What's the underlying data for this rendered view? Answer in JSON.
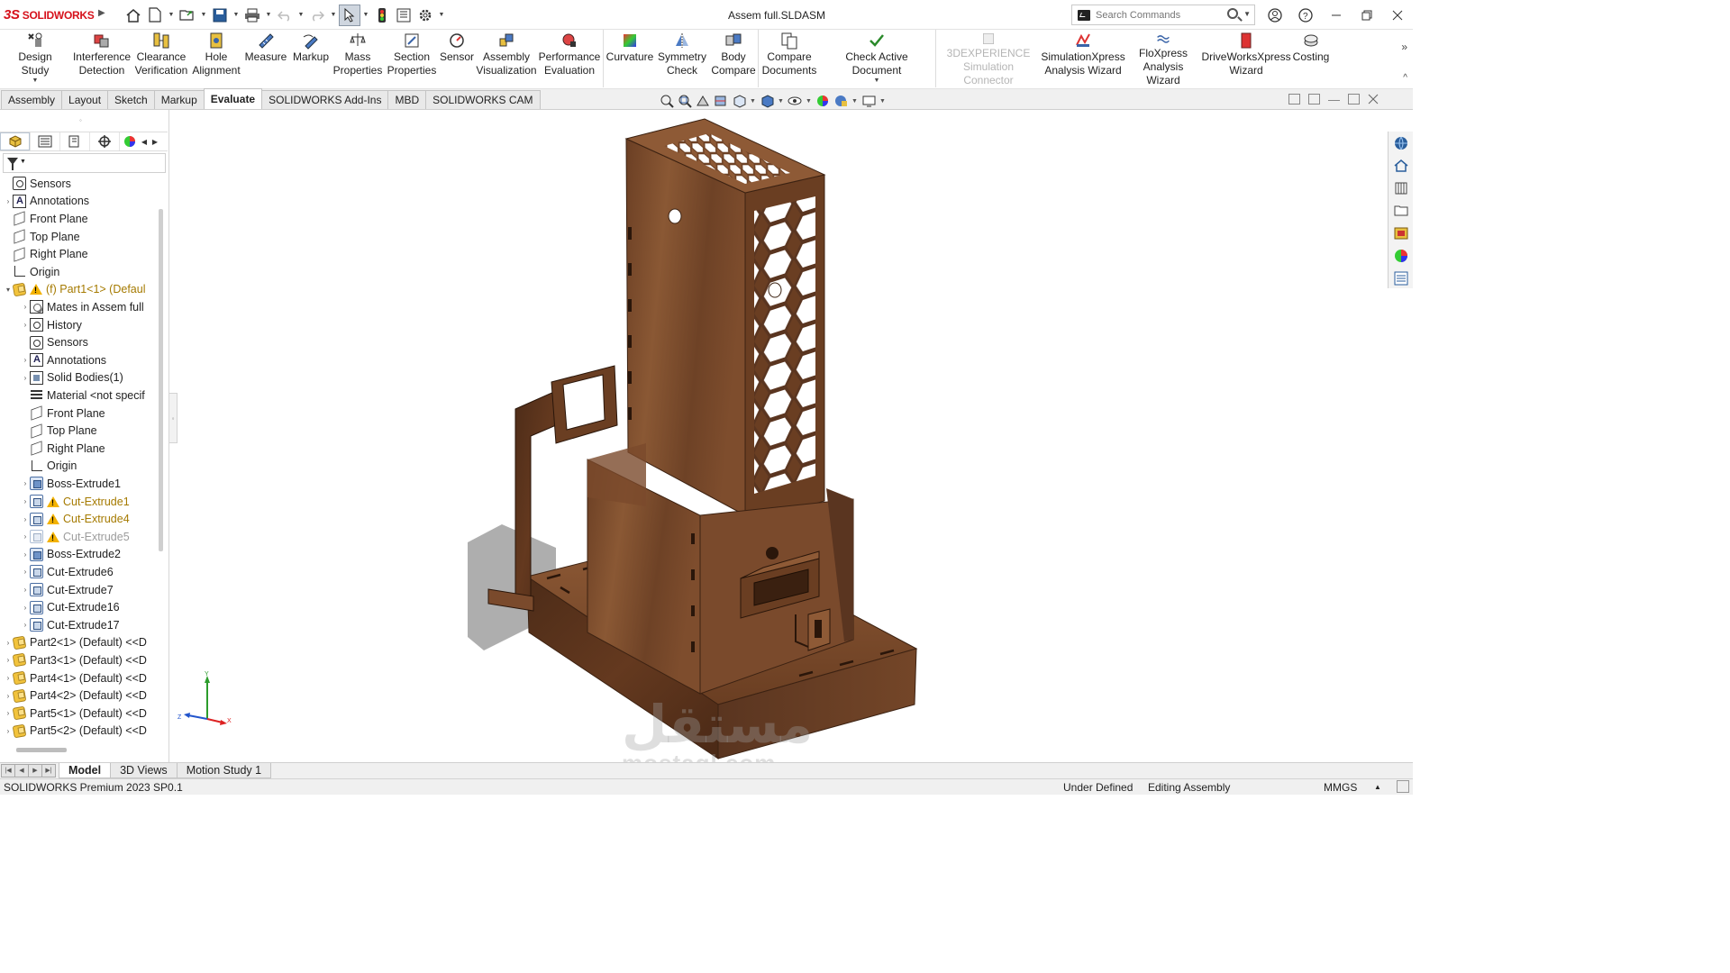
{
  "app": {
    "brand": "SOLIDWORKS",
    "document_title": "Assem full.SLDASM"
  },
  "search": {
    "placeholder": "Search Commands"
  },
  "ribbon": {
    "buttons": [
      {
        "label": "Design Study",
        "icon": "design-study-icon"
      },
      {
        "label": "Interference Detection",
        "icon": "interference-icon"
      },
      {
        "label": "Clearance Verification",
        "icon": "clearance-icon"
      },
      {
        "label": "Hole Alignment",
        "icon": "hole-alignment-icon"
      },
      {
        "label": "Measure",
        "icon": "measure-icon"
      },
      {
        "label": "Markup",
        "icon": "markup-icon"
      },
      {
        "label": "Mass Properties",
        "icon": "mass-properties-icon"
      },
      {
        "label": "Section Properties",
        "icon": "section-properties-icon"
      },
      {
        "label": "Sensor",
        "icon": "sensor-icon"
      },
      {
        "label": "Assembly Visualization",
        "icon": "assembly-visualization-icon"
      },
      {
        "label": "Performance Evaluation",
        "icon": "performance-icon"
      },
      {
        "label": "Curvature",
        "icon": "curvature-icon"
      },
      {
        "label": "Symmetry Check",
        "icon": "symmetry-icon"
      },
      {
        "label": "Body Compare",
        "icon": "body-compare-icon"
      },
      {
        "label": "Compare Documents",
        "icon": "compare-docs-icon"
      },
      {
        "label": "Check Active Document",
        "icon": "check-doc-icon"
      },
      {
        "label": "3DEXPERIENCE Simulation Connector",
        "icon": "3dexperience-icon"
      },
      {
        "label": "SimulationXpress Analysis Wizard",
        "icon": "simxpress-icon"
      },
      {
        "label": "FloXpress Analysis Wizard",
        "icon": "floxpress-icon"
      },
      {
        "label": "DriveWorksXpress Wizard",
        "icon": "driveworks-icon"
      },
      {
        "label": "Costing",
        "icon": "costing-icon"
      }
    ]
  },
  "tabs": [
    "Assembly",
    "Layout",
    "Sketch",
    "Markup",
    "Evaluate",
    "SOLIDWORKS Add-Ins",
    "MBD",
    "SOLIDWORKS CAM"
  ],
  "active_tab": "Evaluate",
  "tree": {
    "items": [
      {
        "label": "Sensors",
        "icon": "sensor",
        "level": 0,
        "expandable": false
      },
      {
        "label": "Annotations",
        "icon": "annot",
        "level": 0,
        "expandable": true
      },
      {
        "label": "Front Plane",
        "icon": "plane",
        "level": 0,
        "expandable": false
      },
      {
        "label": "Top Plane",
        "icon": "plane",
        "level": 0,
        "expandable": false
      },
      {
        "label": "Right Plane",
        "icon": "plane",
        "level": 0,
        "expandable": false
      },
      {
        "label": "Origin",
        "icon": "origin",
        "level": 0,
        "expandable": false
      },
      {
        "label": "(f) Part1<1> (Defaul",
        "icon": "part",
        "level": 0,
        "expandable": true,
        "expanded": true,
        "warning": true
      },
      {
        "label": "Mates in Assem full",
        "icon": "mates",
        "level": 1,
        "expandable": true
      },
      {
        "label": "History",
        "icon": "history",
        "level": 1,
        "expandable": true
      },
      {
        "label": "Sensors",
        "icon": "sensor",
        "level": 1,
        "expandable": false
      },
      {
        "label": "Annotations",
        "icon": "annot",
        "level": 1,
        "expandable": true
      },
      {
        "label": "Solid Bodies(1)",
        "icon": "solid",
        "level": 1,
        "expandable": true
      },
      {
        "label": "Material <not specif",
        "icon": "material",
        "level": 1,
        "expandable": false
      },
      {
        "label": "Front Plane",
        "icon": "plane",
        "level": 1,
        "expandable": false
      },
      {
        "label": "Top Plane",
        "icon": "plane",
        "level": 1,
        "expandable": false
      },
      {
        "label": "Right Plane",
        "icon": "plane",
        "level": 1,
        "expandable": false
      },
      {
        "label": "Origin",
        "icon": "origin",
        "level": 1,
        "expandable": false
      },
      {
        "label": "Boss-Extrude1",
        "icon": "feat",
        "level": 1,
        "expandable": true
      },
      {
        "label": "Cut-Extrude1",
        "icon": "cut",
        "level": 1,
        "expandable": true,
        "warning": true
      },
      {
        "label": "Cut-Extrude4",
        "icon": "cut",
        "level": 1,
        "expandable": true,
        "warning": true
      },
      {
        "label": "Cut-Extrude5",
        "icon": "cut",
        "level": 1,
        "expandable": true,
        "warning": true,
        "suppressed": true
      },
      {
        "label": "Boss-Extrude2",
        "icon": "feat",
        "level": 1,
        "expandable": true
      },
      {
        "label": "Cut-Extrude6",
        "icon": "cut",
        "level": 1,
        "expandable": true
      },
      {
        "label": "Cut-Extrude7",
        "icon": "cut",
        "level": 1,
        "expandable": true
      },
      {
        "label": "Cut-Extrude16",
        "icon": "cut",
        "level": 1,
        "expandable": true
      },
      {
        "label": "Cut-Extrude17",
        "icon": "cut",
        "level": 1,
        "expandable": true
      },
      {
        "label": "Part2<1> (Default) <<D",
        "icon": "part",
        "level": 0,
        "expandable": true
      },
      {
        "label": "Part3<1> (Default) <<D",
        "icon": "part",
        "level": 0,
        "expandable": true
      },
      {
        "label": "Part4<1> (Default) <<D",
        "icon": "part",
        "level": 0,
        "expandable": true
      },
      {
        "label": "Part4<2> (Default) <<D",
        "icon": "part",
        "level": 0,
        "expandable": true
      },
      {
        "label": "Part5<1> (Default) <<D",
        "icon": "part",
        "level": 0,
        "expandable": true
      },
      {
        "label": "Part5<2> (Default) <<D",
        "icon": "part",
        "level": 0,
        "expandable": true
      }
    ]
  },
  "bottom_tabs": [
    "Model",
    "3D Views",
    "Motion Study 1"
  ],
  "active_bottom_tab": "Model",
  "status": {
    "product": "SOLIDWORKS Premium 2023 SP0.1",
    "definition": "Under Defined",
    "mode": "Editing Assembly",
    "units": "MMGS"
  },
  "triad": {
    "x": "X",
    "y": "Y",
    "z": "Z"
  },
  "watermark": {
    "arabic": "مستقل",
    "latin": "mostaql.com"
  },
  "colors": {
    "brand_red": "#d6111b",
    "wood_dark": "#5a3520",
    "wood_mid": "#7a4a2c",
    "wood_light": "#8e5a36",
    "warning": "#f3b200"
  }
}
